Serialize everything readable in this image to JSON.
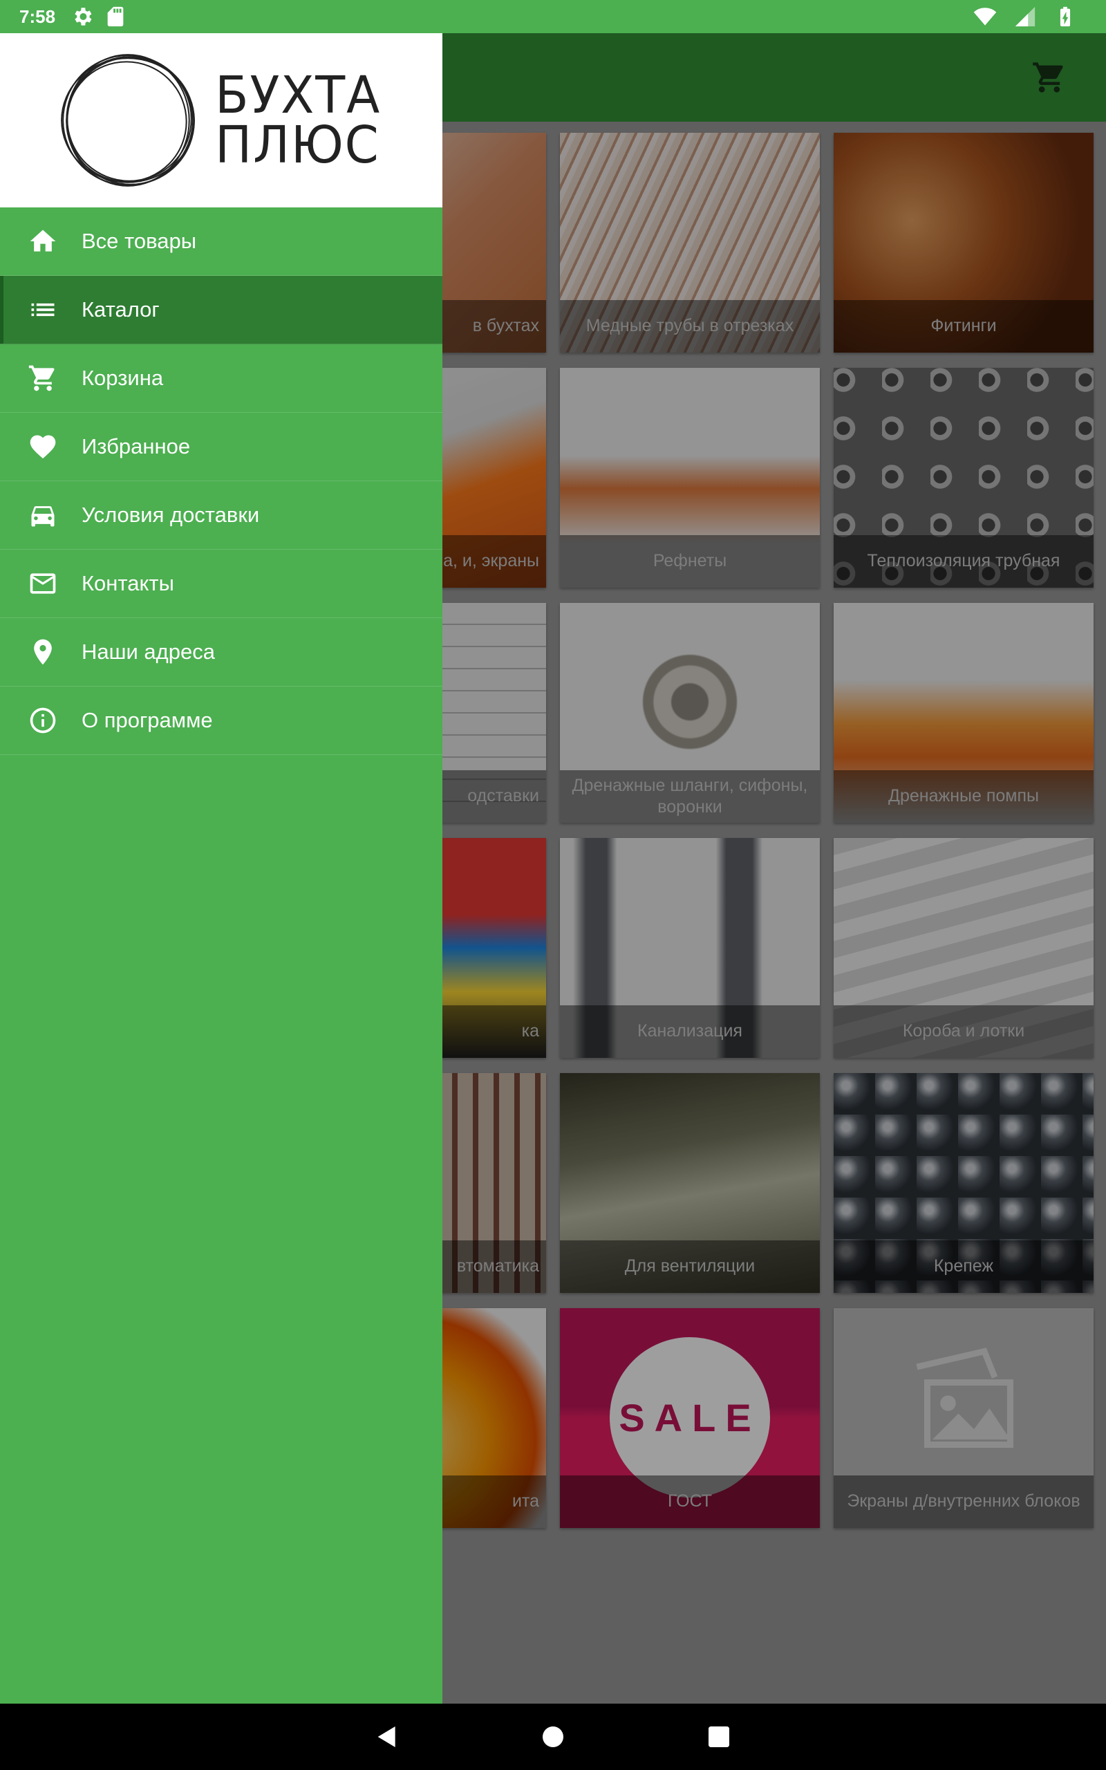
{
  "status_bar": {
    "time": "7:58",
    "icons_left": [
      "gear-icon",
      "sd-card-icon"
    ],
    "icons_right": [
      "wifi-icon",
      "signal-icon",
      "battery-charging-icon"
    ]
  },
  "app_bar": {
    "cart_icon": "cart-icon"
  },
  "drawer": {
    "logo": {
      "line1": "БУХТА",
      "line2": "ПЛЮС"
    },
    "items": [
      {
        "label": "Все товары",
        "icon": "home-icon",
        "active": false
      },
      {
        "label": "Каталог",
        "icon": "list-icon",
        "active": true
      },
      {
        "label": "Корзина",
        "icon": "cart-icon",
        "active": false
      },
      {
        "label": "Избранное",
        "icon": "heart-icon",
        "active": false
      },
      {
        "label": "Условия доставки",
        "icon": "car-icon",
        "active": false
      },
      {
        "label": "Контакты",
        "icon": "mail-icon",
        "active": false
      },
      {
        "label": "Наши адреса",
        "icon": "location-pin-icon",
        "active": false
      },
      {
        "label": "О программе",
        "icon": "info-icon",
        "active": false
      }
    ]
  },
  "catalog": {
    "tiles": [
      {
        "label": "в бухтах"
      },
      {
        "label": "Медные трубы в отрезках"
      },
      {
        "label": "Фитинги"
      },
      {
        "label": "ты, масла, и, экраны"
      },
      {
        "label": "Рефнеты"
      },
      {
        "label": "Теплоизоляция трубная"
      },
      {
        "label": "одставки"
      },
      {
        "label": "Дренажные шланги, сифоны, воронки"
      },
      {
        "label": "Дренажные помпы"
      },
      {
        "label": "ка"
      },
      {
        "label": "Канализация"
      },
      {
        "label": "Короба и лотки"
      },
      {
        "label": "втоматика"
      },
      {
        "label": "Для вентиляции"
      },
      {
        "label": "Крепеж"
      },
      {
        "label": "ита"
      },
      {
        "label": "ГОСТ"
      },
      {
        "label": "Экраны д/внутренних блоков"
      }
    ],
    "sale_badge": "SALE"
  },
  "colors": {
    "primary": "#4caf50",
    "primary_dark": "#2e7d32",
    "app_bar_dimmed": "#1f5a21"
  }
}
